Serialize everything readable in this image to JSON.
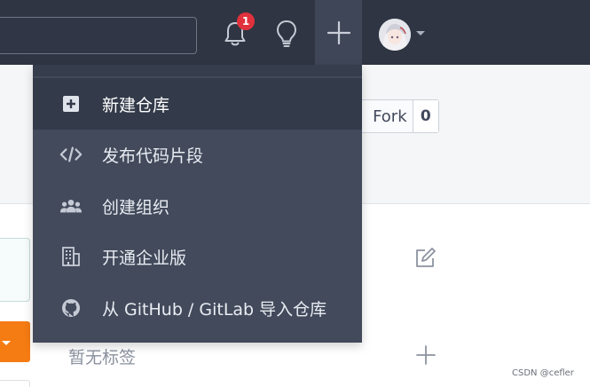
{
  "navbar": {
    "search_placeholder": "",
    "notification_count": "1",
    "icons": [
      "bell-icon",
      "lightbulb-icon",
      "plus-icon",
      "avatar",
      "chevron-down-icon"
    ]
  },
  "repo": {
    "fork_label": "Fork",
    "fork_count": "0"
  },
  "sidebar": {
    "tags_label": "暂无标签"
  },
  "dropdown": {
    "items": [
      {
        "label": "新建仓库",
        "icon": "plus-square-icon"
      },
      {
        "label": "发布代码片段",
        "icon": "code-icon"
      },
      {
        "label": "创建组织",
        "icon": "users-icon"
      },
      {
        "label": "开通企业版",
        "icon": "building-icon"
      },
      {
        "label": "从 GitHub / GitLab 导入仓库",
        "icon": "github-icon"
      }
    ]
  },
  "watermark": "CSDN @cefler",
  "colors": {
    "navbar": "#2f3542",
    "dropdown": "#424a5b",
    "active_item": "#333a49",
    "badge": "#e0313c",
    "orange": "#f57b13"
  }
}
